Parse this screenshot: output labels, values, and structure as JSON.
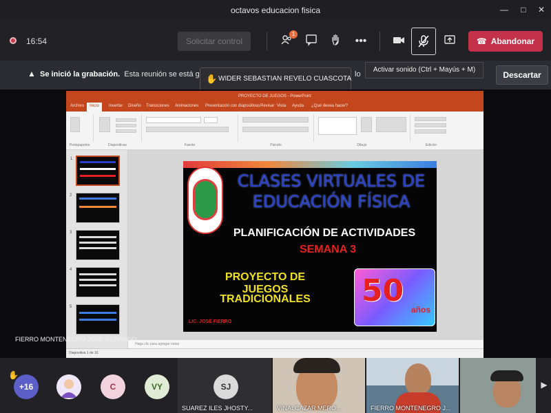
{
  "window": {
    "title": "octavos educacion fisica"
  },
  "toolbar": {
    "timer": "16:54",
    "control_label": "Solicitar control",
    "participants_badge": "1",
    "leave_label": "Abandonar",
    "icons": [
      "participants-icon",
      "chat-icon",
      "raise-hand-icon",
      "more-icon",
      "camera-icon",
      "mic-muted-icon",
      "share-icon",
      "hangup-icon"
    ]
  },
  "banner": {
    "bold": "Se inició la grabación.",
    "text": "Esta reunión se está grab",
    "tail": "lo",
    "dismiss_label": "Descartar"
  },
  "tooltips": {
    "raised_hand": "WIDER SEBASTIAN REVELO CUASCOTA",
    "mic": "Activar sonido (Ctrl + Mayús + M)"
  },
  "powerpoint": {
    "title": "PROYECTO DE JUEGOS - PowerPoint",
    "tabs": [
      "Archivo",
      "Inicio",
      "Insertar",
      "Diseño",
      "Transiciones",
      "Animaciones",
      "Presentación con diapositivas",
      "Revisar",
      "Vista",
      "Ayuda",
      "¿Qué desea hacer?"
    ],
    "active_tab": "Inicio",
    "groups": [
      "Portapapeles",
      "Diapositivas",
      "Fuente",
      "Párrafo",
      "Dibujo",
      "Edición"
    ],
    "notes_placeholder": "Haga clic para agregar notas",
    "status": "Diapositiva 1 de 16"
  },
  "slide": {
    "title": "CLASES VIRTUALES DE EDUCACIÓN FÍSICA",
    "subtitle": "PLANIFICACIÓN DE ACTIVIDADES",
    "week": "SEMANA 3",
    "project_line1": "PROYECTO DE JUEGOS",
    "project_line2": "TRADICIONALES",
    "author": "LIC. JOSÉ FIERRO",
    "badge_number": "50",
    "badge_word": "años"
  },
  "presenter": {
    "name": "FIERRO MONTENEGRO JOSE GERARDO"
  },
  "participants": {
    "more_count": "+16",
    "avatars": [
      {
        "initials": "",
        "color": "#d9d0ea"
      },
      {
        "initials": "C",
        "color": "#f2d2dc"
      },
      {
        "initials": "VY",
        "color": "#e0ecd6"
      },
      {
        "initials": "SJ",
        "color": "#dadada"
      }
    ],
    "tiles": [
      {
        "name": "SUAREZ ILES JHOSTY..."
      },
      {
        "name": "VINALCAZAR MERO..."
      },
      {
        "name": "FIERRO MONTENEGRO J..."
      },
      {
        "name": ""
      }
    ]
  }
}
